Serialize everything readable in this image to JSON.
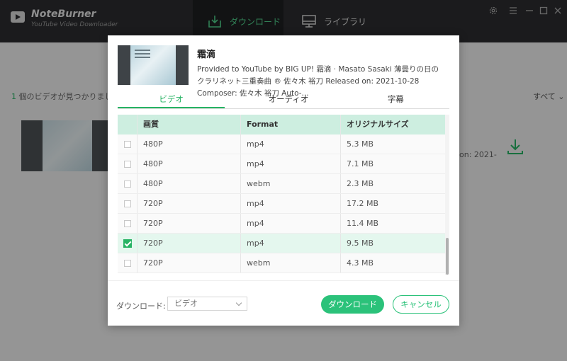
{
  "app": {
    "name": "NoteBurner",
    "subtitle": "YouTube Video Downloader",
    "accent": "#27b364"
  },
  "nav": {
    "tabs": [
      {
        "label": "ダウンロード",
        "icon": "download-tray-icon",
        "active": true
      },
      {
        "label": "ライブラリ",
        "icon": "monitor-icon",
        "active": false
      }
    ]
  },
  "window_controls": [
    "gear-icon",
    "minimize-icon",
    "maximize-icon",
    "close-icon"
  ],
  "background": {
    "found_count": "1",
    "found_text": " 個のビデオが見つかりまし",
    "sort_label": "すべて",
    "item_info": "on: 2021-"
  },
  "dialog": {
    "video_title": "霜滴",
    "video_desc": "Provided to YouTube by BIG UP! 霜滴 · Masato Sasaki 薄曇りの日のクラリネット三重奏曲 ® 佐々木 裕刀 Released on: 2021-10-28 Composer: 佐々木 裕刀 Auto-...",
    "tabs": [
      {
        "label": "ビデオ",
        "active": true
      },
      {
        "label": "オーディオ",
        "active": false
      },
      {
        "label": "字幕",
        "active": false
      }
    ],
    "table": {
      "headers": [
        "画質",
        "Format",
        "オリジナルサイズ"
      ],
      "rows": [
        {
          "quality": "480P",
          "format": "mp4",
          "size": "5.3 MB",
          "checked": false
        },
        {
          "quality": "480P",
          "format": "mp4",
          "size": "7.1 MB",
          "checked": false
        },
        {
          "quality": "480P",
          "format": "webm",
          "size": "2.3 MB",
          "checked": false
        },
        {
          "quality": "720P",
          "format": "mp4",
          "size": "17.2 MB",
          "checked": false
        },
        {
          "quality": "720P",
          "format": "mp4",
          "size": "11.4 MB",
          "checked": false
        },
        {
          "quality": "720P",
          "format": "mp4",
          "size": "9.5 MB",
          "checked": true
        },
        {
          "quality": "720P",
          "format": "webm",
          "size": "4.3 MB",
          "checked": false
        }
      ]
    },
    "download_label": "ダウンロード:",
    "download_select": "ビデオ",
    "download_button": "ダウンロード",
    "cancel_button": "キャンセル"
  }
}
